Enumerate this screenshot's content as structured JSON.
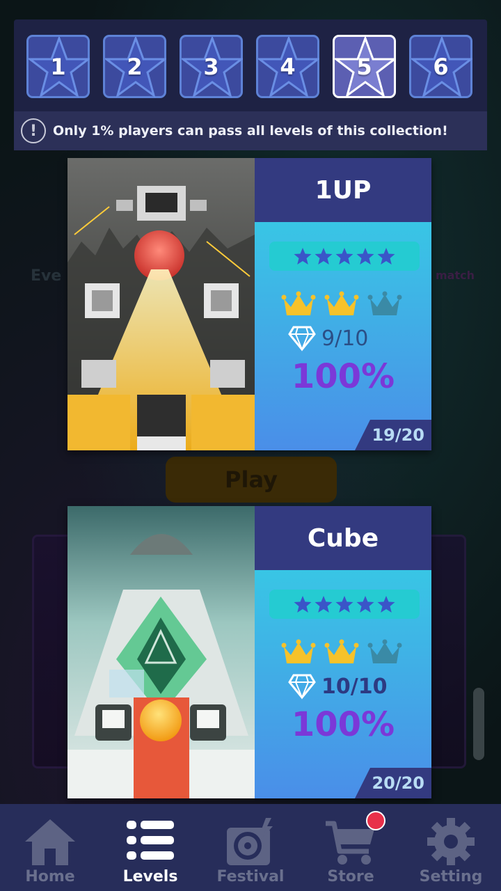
{
  "collection_tabs": [
    {
      "label": "1",
      "active": false
    },
    {
      "label": "2",
      "active": false
    },
    {
      "label": "3",
      "active": false
    },
    {
      "label": "4",
      "active": false
    },
    {
      "label": "5",
      "active": true
    },
    {
      "label": "6",
      "active": false
    }
  ],
  "notice": {
    "icon": "exclamation-icon",
    "text": "Only 1%  players can pass all levels of this collection!"
  },
  "background": {
    "play_label": "Play",
    "event_label": "Eve",
    "match_label": "y match"
  },
  "levels": [
    {
      "title": "1UP",
      "stars": 5,
      "crowns_earned": 2,
      "crowns_total": 3,
      "gems": "9/10",
      "percent": "100%",
      "progress": "19/20"
    },
    {
      "title": "Cube",
      "stars": 5,
      "crowns_earned": 2,
      "crowns_total": 3,
      "gems": "10/10",
      "percent": "100%",
      "progress": "20/20"
    }
  ],
  "nav": [
    {
      "label": "Home",
      "icon": "home-icon",
      "active": false
    },
    {
      "label": "Levels",
      "icon": "list-icon",
      "active": true
    },
    {
      "label": "Festival",
      "icon": "record-player-icon",
      "active": false
    },
    {
      "label": "Store",
      "icon": "cart-icon",
      "active": false,
      "badge": true
    },
    {
      "label": "Setting",
      "icon": "gear-icon",
      "active": false
    }
  ],
  "colors": {
    "panel": "#1e2244",
    "title_bar": "#333a80",
    "crown_gold": "#f6c22a",
    "crown_empty": "#3a8aa6",
    "percent": "#7b38d8",
    "badge": "#e8304a"
  }
}
